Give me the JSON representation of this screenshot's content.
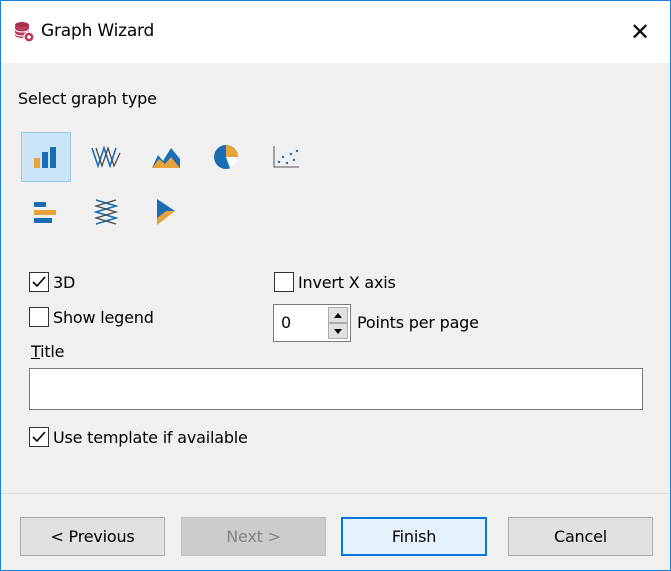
{
  "window": {
    "title": "Graph Wizard",
    "close_glyph": "✕"
  },
  "graph_type": {
    "label": "Select graph type",
    "types": [
      {
        "icon": "bar-chart-icon",
        "selected": true
      },
      {
        "icon": "line-chart-icon",
        "selected": false
      },
      {
        "icon": "area-chart-icon",
        "selected": false
      },
      {
        "icon": "pie-chart-icon",
        "selected": false
      },
      {
        "icon": "scatter-chart-icon",
        "selected": false
      },
      {
        "icon": "horizontal-bar-chart-icon",
        "selected": false
      },
      {
        "icon": "radar-chart-icon",
        "selected": false
      },
      {
        "icon": "funnel-chart-icon",
        "selected": false
      }
    ]
  },
  "options": {
    "three_d": {
      "label": "3D",
      "checked": true
    },
    "invert_x": {
      "label": "Invert X axis",
      "checked": false
    },
    "show_legend": {
      "label": "Show legend",
      "checked": false
    },
    "points_per_page": {
      "value": "0",
      "label": "Points per page"
    },
    "use_template": {
      "label": "Use template if available",
      "checked": true
    }
  },
  "title_field": {
    "label_mnemonic": "T",
    "label_rest": "itle",
    "value": ""
  },
  "buttons": {
    "previous": "< Previous",
    "next": "Next >",
    "finish": "Finish",
    "cancel": "Cancel"
  },
  "colors": {
    "accent": "#0078d7",
    "icon_blue": "#1a6eb5",
    "icon_orange": "#e8a23a",
    "selection": "#cce4f7"
  }
}
